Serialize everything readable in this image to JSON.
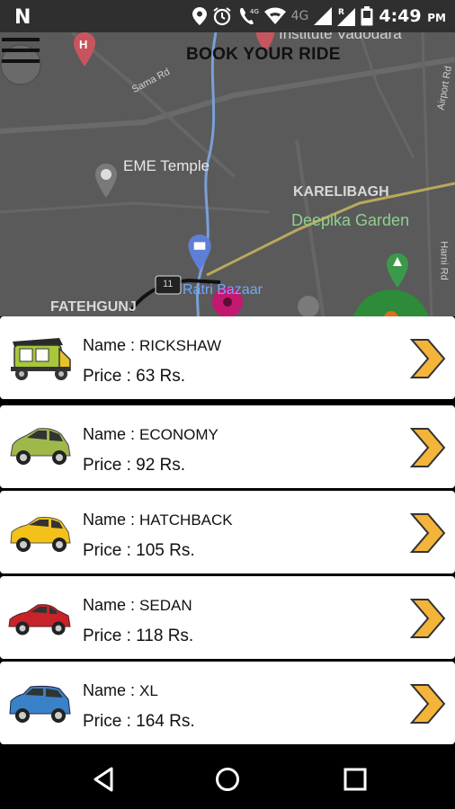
{
  "status_bar": {
    "carrier_icon": "N",
    "network_type": "4G",
    "time": "4:49",
    "ampm": "PM",
    "icons": [
      "location-icon",
      "alarm-icon",
      "wifi-call-icon",
      "wifi-icon",
      "signal-icon",
      "roaming-signal-icon",
      "battery-icon"
    ]
  },
  "header": {
    "title": "BOOK YOUR RIDE",
    "menu_icon": "hamburger-menu-icon"
  },
  "map": {
    "labels": {
      "institute": "Institute Vadodara",
      "sama_rd": "Sama Rd",
      "airport_rd": "Airport Rd",
      "eme_temple": "EME Temple",
      "karelibagh": "KARELIBAGH",
      "deepika_garden": "Deepika Garden",
      "harni_rd": "Harni Rd",
      "fatehgunj": "FATEHGUNJ",
      "ratri_bazaar": "Ratri Bazaar",
      "route_11": "11"
    }
  },
  "rides": [
    {
      "name_label": "Name : ",
      "name": "RICKSHAW",
      "price_label": "Price : ",
      "price": "63",
      "currency": " Rs.",
      "icon": "rickshaw-icon"
    },
    {
      "name_label": "Name : ",
      "name": "ECONOMY",
      "price_label": "Price : ",
      "price": "92",
      "currency": " Rs.",
      "icon": "economy-car-icon"
    },
    {
      "name_label": "Name : ",
      "name": "HATCHBACK",
      "price_label": "Price : ",
      "price": "105",
      "currency": " Rs.",
      "icon": "hatchback-car-icon"
    },
    {
      "name_label": "Name : ",
      "name": "SEDAN",
      "price_label": "Price : ",
      "price": "118",
      "currency": " Rs.",
      "icon": "sedan-car-icon"
    },
    {
      "name_label": "Name : ",
      "name": "XL",
      "price_label": "Price : ",
      "price": "164",
      "currency": " Rs.",
      "icon": "xl-car-icon"
    }
  ],
  "colors": {
    "chevron": "#f4b43a",
    "economy": "#9fb84a",
    "hatchback": "#f2c21b",
    "sedan": "#c8232a",
    "xl": "#3a82c8",
    "rickshaw_body": "#a8c83a"
  },
  "nav_bar": {
    "icons": [
      "back-icon",
      "home-icon",
      "recents-icon"
    ]
  }
}
